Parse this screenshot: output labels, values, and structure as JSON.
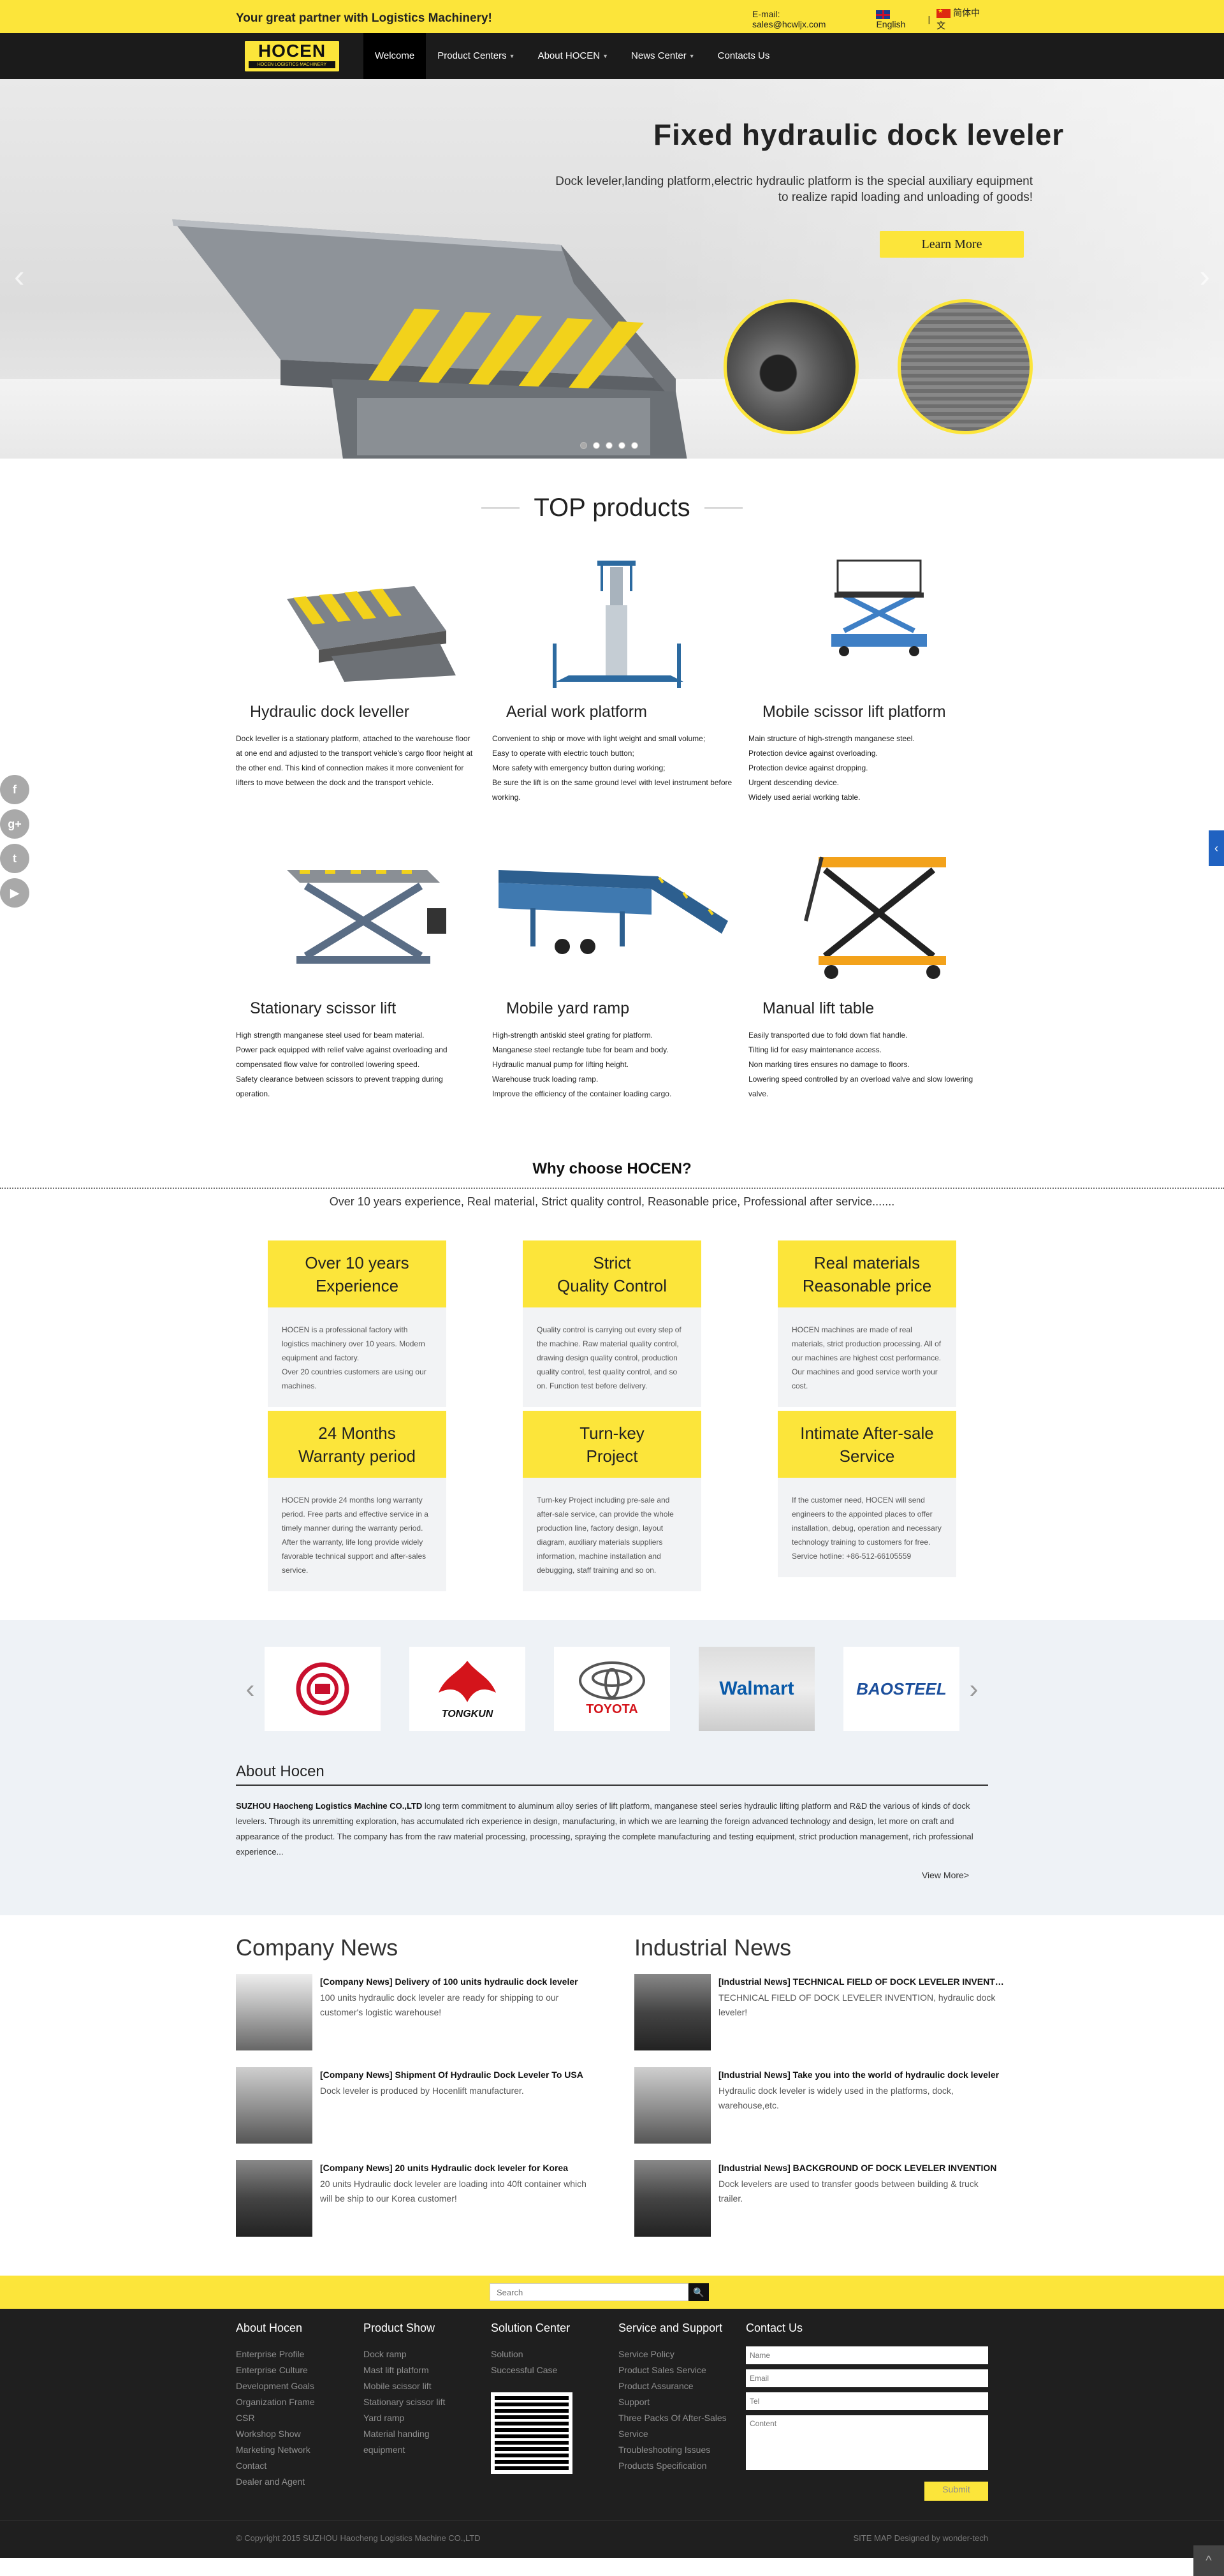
{
  "topbar": {
    "tagline": "Your great partner with Logistics Machinery!",
    "email": "E-mail: sales@hcwljx.com",
    "lang_en": "English",
    "lang_sep": "|",
    "lang_cn": "简体中文"
  },
  "brand": {
    "logo_text": "HOCEN",
    "logo_sub": "HOCEN LOGISTICS MACHINERY",
    "accent": "#fce53a"
  },
  "nav": [
    {
      "label": "Welcome",
      "active": true,
      "dropdown": false
    },
    {
      "label": "Product Centers",
      "dropdown": true
    },
    {
      "label": "About HOCEN",
      "dropdown": true
    },
    {
      "label": "News Center",
      "dropdown": true
    },
    {
      "label": "Contacts Us",
      "dropdown": false
    }
  ],
  "hero": {
    "title": "Fixed hydraulic dock leveler",
    "desc": "Dock leveler,landing platform,electric hydraulic platform is the special auxiliary equipment to realize rapid loading and unloading of goods!",
    "button": "Learn More",
    "prev_icon": "‹",
    "next_icon": "›"
  },
  "top_products": {
    "title": "TOP products",
    "items": [
      {
        "name": "Hydraulic dock leveller",
        "desc": "Dock leveller is a stationary platform, attached to the warehouse floor at one end and adjusted to the transport vehicle's cargo floor height at the other end. This kind of connection makes it more convenient for lifters to move between the dock and the transport vehicle."
      },
      {
        "name": "Aerial work platform",
        "desc": "Convenient to ship or move with light weight and small volume;\nEasy to operate with electric touch button;\nMore safety with emergency button during working;\nBe sure the lift is on the same ground level with level instrument before working."
      },
      {
        "name": "Mobile scissor lift platform",
        "desc": "Main structure of high-strength manganese steel.\nProtection device against overloading.\nProtection device against dropping.\nUrgent descending device.\nWidely used aerial working table."
      },
      {
        "name": "Stationary scissor lift",
        "desc": "High strength manganese steel used for beam material.\nPower pack equipped with relief valve against overloading and compensated flow valve for controlled lowering speed.\nSafety clearance between scissors to prevent trapping during operation."
      },
      {
        "name": "Mobile yard ramp",
        "desc": "High-strength antiskid steel grating for platform.\nManganese steel rectangle tube for beam and body.\nHydraulic manual pump for lifting height.\nWarehouse truck loading ramp.\nImprove the efficiency of the container loading cargo."
      },
      {
        "name": "Manual lift table",
        "desc": "Easily transported due to fold down flat handle.\nTilting lid for easy maintenance access.\nNon marking tires ensures no damage to floors.\nLowering speed controlled by an overload valve and slow lowering valve."
      }
    ]
  },
  "why": {
    "title": "Why choose HOCEN?",
    "subtitle": "Over 10 years experience, Real material, Strict quality control, Reasonable price, Professional after service.......",
    "cards": [
      {
        "head": "Over 10 years\nExperience",
        "body": "HOCEN is a professional factory with logistics machinery over 10 years. Modern equipment and factory.\nOver 20 countries customers are using our machines."
      },
      {
        "head": "Strict\nQuality Control",
        "body": "Quality control is carrying out every step of the machine. Raw material quality control, drawing design quality control, production quality control, test quality control, and so on. Function test before delivery."
      },
      {
        "head": "Real materials\nReasonable price",
        "body": "HOCEN machines are made of real materials, strict production processing.  All of our machines are highest cost performance.  Our machines and good service worth your cost."
      },
      {
        "head": "24 Months\nWarranty period",
        "body": "HOCEN provide 24 months long warranty period.  Free parts and effective service in a timely manner during the warranty period.\nAfter the warranty, life long provide widely favorable technical support and after-sales service."
      },
      {
        "head": "Turn-key\nProject",
        "body": "Turn-key Project including pre-sale and after-sale service, can provide the whole production line, factory design, layout diagram, auxiliary materials suppliers information, machine installation and debugging, staff training and so on."
      },
      {
        "head": "Intimate After-sale\nService",
        "body": "If the customer need, HOCEN will send engineers to the appointed places to offer installation, debug, operation and necessary technology training to customers for free.\nService hotline: +86-512-66105559"
      }
    ]
  },
  "partners": {
    "prev_icon": "‹",
    "next_icon": "›",
    "logos": [
      {
        "name": "",
        "icon": "bank-logo"
      },
      {
        "name": "TONGKUN",
        "icon": "tongkun-logo"
      },
      {
        "name": "TOYOTA",
        "icon": "toyota-logo"
      },
      {
        "name": "Walmart",
        "icon": "walmart-logo"
      },
      {
        "name": "BAOSTEEL",
        "icon": "baosteel-logo"
      }
    ]
  },
  "about": {
    "title": "About Hocen",
    "company": "SUZHOU Haocheng Logistics Machine CO.,LTD",
    "text": " long term commitment to aluminum alloy series of lift platform, manganese steel series hydraulic lifting platform and R&D the various of kinds of dock levelers. Through its unremitting exploration, has accumulated rich experience in design, manufacturing, in which we are learning the foreign advanced technology and design, let more on craft and appearance of the product. The company has from the raw material processing, processing, spraying the complete manufacturing and testing equipment, strict production management, rich professional experience...",
    "view_more": "View More>"
  },
  "news": {
    "company_title": "Company News",
    "industry_title": "Industrial News",
    "company": [
      {
        "title": "[Company News] Delivery of 100 units hydraulic dock leveler",
        "desc": "100 units hydraulic dock leveler are ready for shipping to our customer's logistic warehouse!"
      },
      {
        "title": "[Company News] Shipment Of Hydraulic Dock Leveler To USA",
        "desc": "Dock leveler is produced by Hocenlift manufacturer."
      },
      {
        "title": "[Company News] 20 units Hydraulic dock leveler for Korea",
        "desc": "20 units Hydraulic dock leveler are loading into 40ft container which will be ship to our Korea customer!"
      }
    ],
    "industry": [
      {
        "title": "[Industrial News] TECHNICAL FIELD OF DOCK LEVELER INVENTION",
        "desc": "TECHNICAL FIELD OF DOCK LEVELER INVENTION, hydraulic dock leveler!"
      },
      {
        "title": "[Industrial News] Take you into the world of hydraulic dock leveler",
        "desc": "Hydraulic dock leveler is widely used in the platforms, dock, warehouse,etc."
      },
      {
        "title": "[Industrial News] BACKGROUND OF DOCK LEVELER INVENTION",
        "desc": "Dock levelers are used to transfer goods between building & truck trailer."
      }
    ]
  },
  "footer": {
    "search_placeholder": "Search",
    "search_icon": "🔍",
    "cols": [
      {
        "title": "About Hocen",
        "links": [
          "Enterprise Profile",
          "Enterprise Culture",
          "Development Goals",
          "Organization Frame",
          "CSR",
          "Workshop Show",
          "Marketing Network",
          "Contact",
          "Dealer and Agent"
        ]
      },
      {
        "title": "Product Show",
        "links": [
          "Dock ramp",
          "Mast lift platform",
          "Mobile scissor lift",
          "Stationary scissor lift",
          "Yard ramp",
          "Material handing\nequipment"
        ]
      },
      {
        "title": "Solution Center",
        "links": [
          "Solution",
          "Successful Case"
        ]
      },
      {
        "title": "Service and Support",
        "links": [
          "Service Policy",
          "Product Sales Service",
          "Product Assurance",
          "Support",
          "Three Packs Of After-Sales\nService",
          "Troubleshooting Issues",
          "Products Specification"
        ]
      }
    ],
    "contact_title": "Contact Us",
    "contact_placeholders": {
      "name": "Name",
      "email": "Email",
      "tel": "Tel",
      "content": "Content"
    },
    "submit": "Submit",
    "copyright": "© Copyright   2015 SUZHOU Haocheng Logistics Machine CO.,LTD",
    "sitemap": "SITE MAP    Designed by  wonder-tech",
    "totop_icon": "^"
  },
  "social": [
    {
      "icon": "facebook-icon",
      "glyph": "f"
    },
    {
      "icon": "google-plus-icon",
      "glyph": "g+"
    },
    {
      "icon": "twitter-icon",
      "glyph": "t"
    },
    {
      "icon": "youtube-icon",
      "glyph": "▶"
    }
  ]
}
